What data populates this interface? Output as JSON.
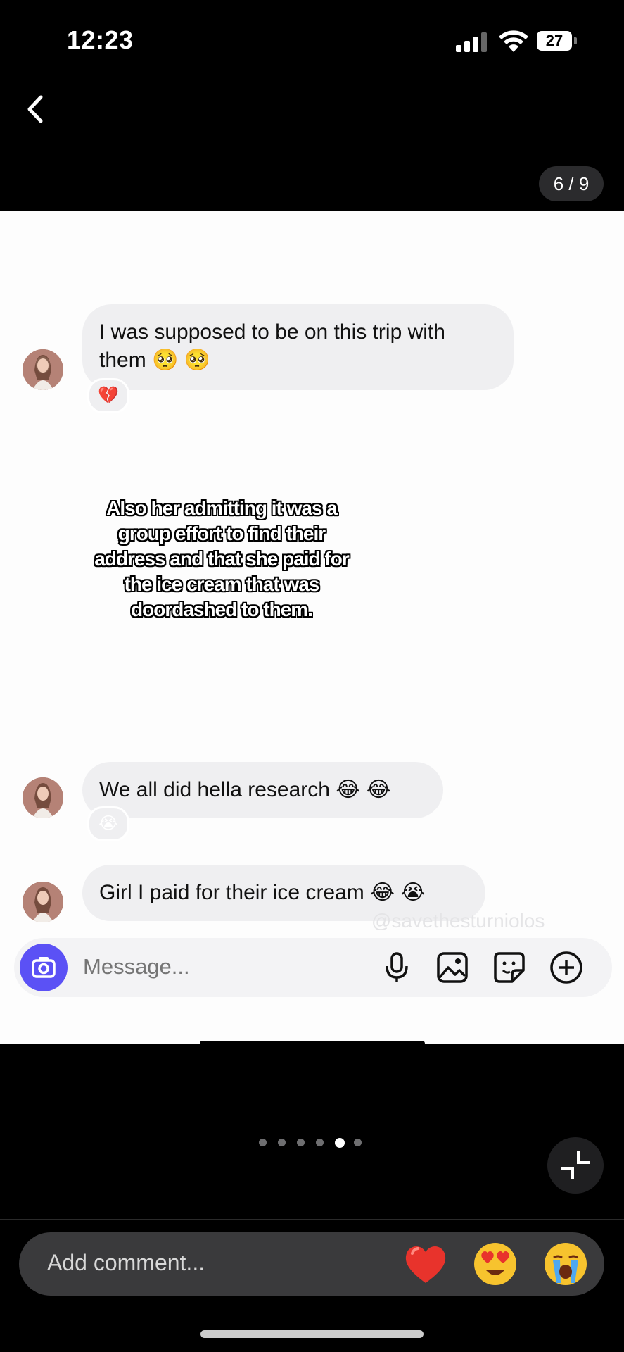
{
  "status_bar": {
    "time": "12:23",
    "battery": "27"
  },
  "header": {
    "page_counter": "6 / 9"
  },
  "chat": {
    "messages": [
      {
        "text": "I was supposed to be on this trip with them 🥺 🥺",
        "reaction": "💔"
      },
      {
        "text": "We all did hella research 😂 😂",
        "reaction": "😭"
      },
      {
        "text": "Girl I paid for their ice cream 😂 😭",
        "reaction": ""
      }
    ],
    "caption": "Also her admitting it was a group effort to find their address and that she paid for the ice cream that was doordashed to them.",
    "watermark": "@savethesturniolos",
    "composer_placeholder": "Message..."
  },
  "carousel": {
    "total_dots": 6,
    "active_index": 4
  },
  "comment_bar": {
    "placeholder": "Add comment...",
    "quick_reactions": [
      "❤️",
      "😍",
      "😭"
    ]
  },
  "colors": {
    "accent": "#5b51f5",
    "bubble": "#efeff1"
  }
}
